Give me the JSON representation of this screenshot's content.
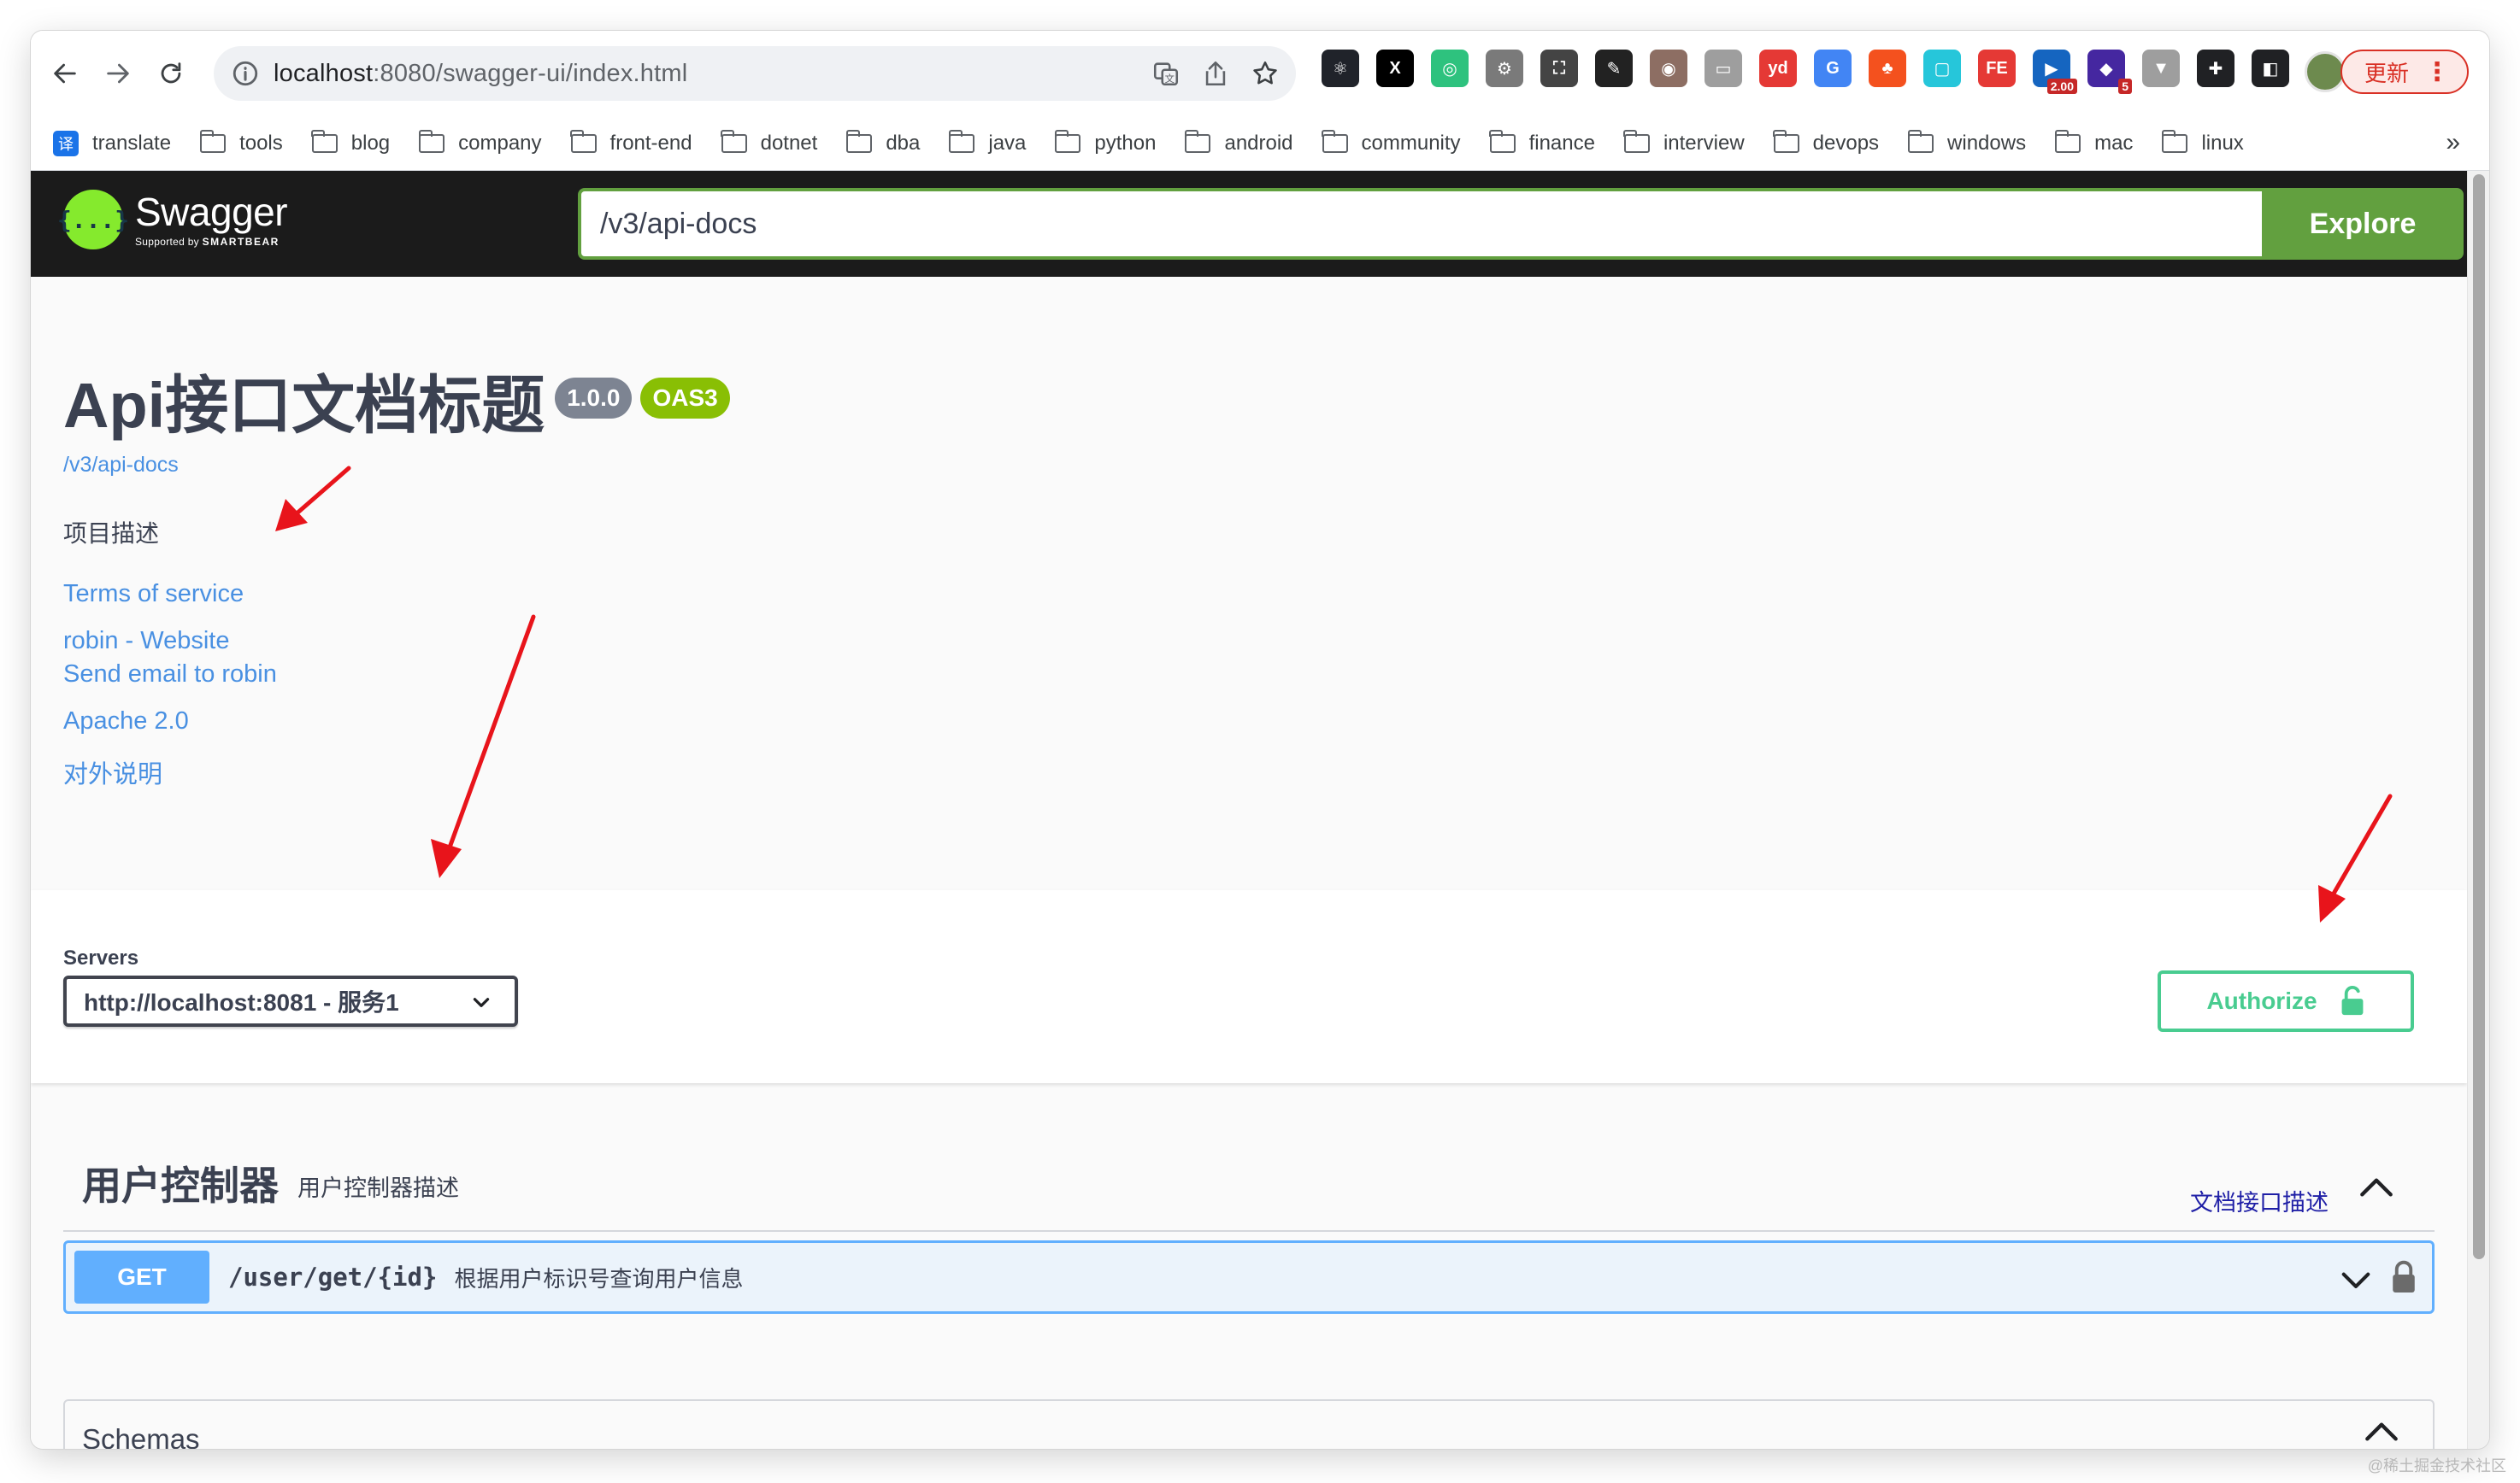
{
  "browser": {
    "url_host": "localhost",
    "url_path": ":8080/swagger-ui/index.html",
    "update_label": "更新",
    "bookmarks": [
      "translate",
      "tools",
      "blog",
      "company",
      "front-end",
      "dotnet",
      "dba",
      "java",
      "python",
      "android",
      "community",
      "finance",
      "interview",
      "devops",
      "windows",
      "mac",
      "linux"
    ],
    "translate_glyph": "译",
    "more": "»",
    "extensions": [
      {
        "name": "react-devtools-icon",
        "label": "⚛",
        "color": "#20232a"
      },
      {
        "name": "x-icon",
        "label": "X",
        "color": "#000000"
      },
      {
        "name": "circle-icon",
        "label": "◎",
        "color": "#2ec27e"
      },
      {
        "name": "gear-ext-icon",
        "label": "⚙",
        "color": "#7a7a7a"
      },
      {
        "name": "screenshot-icon",
        "label": "⛶",
        "color": "#444444"
      },
      {
        "name": "eyedropper-icon",
        "label": "✎",
        "color": "#222222"
      },
      {
        "name": "owl-icon",
        "label": "◉",
        "color": "#8d6e63"
      },
      {
        "name": "reader-icon",
        "label": "▭",
        "color": "#9e9e9e"
      },
      {
        "name": "youdao-icon",
        "label": "yd",
        "color": "#e53935"
      },
      {
        "name": "google-translate-icon",
        "label": "G",
        "color": "#4285f4"
      },
      {
        "name": "tree-icon",
        "label": "♣",
        "color": "#f4511e"
      },
      {
        "name": "frame-icon",
        "label": "▢",
        "color": "#26c6da"
      },
      {
        "name": "fe-icon",
        "label": "FE",
        "color": "#e53935"
      },
      {
        "name": "speed-icon",
        "label": "▶",
        "color": "#1565c0",
        "badge": "2.00"
      },
      {
        "name": "cube-icon",
        "label": "◆",
        "color": "#4527a0",
        "badge": "5"
      },
      {
        "name": "vue-icon",
        "label": "▼",
        "color": "#9e9e9e"
      },
      {
        "name": "puzzle-icon",
        "label": "✚",
        "color": "#202124"
      },
      {
        "name": "sidepanel-icon",
        "label": "◧",
        "color": "#202124"
      }
    ]
  },
  "swagger": {
    "logo_glyph": "{...}",
    "logo_name": "Swagger",
    "logo_sub_prefix": "Supported by",
    "logo_sub_brand": "SMARTBEAR",
    "url_input": "/v3/api-docs",
    "explore_label": "Explore"
  },
  "info": {
    "title": "Api接口文档标题",
    "version": "1.0.0",
    "oas": "OAS3",
    "url": "/v3/api-docs",
    "description": "项目描述",
    "links": {
      "terms": "Terms of service",
      "website": "robin - Website",
      "email": "Send email to robin",
      "license": "Apache 2.0",
      "external": "对外说明"
    }
  },
  "servers": {
    "label": "Servers",
    "selected": "http://localhost:8081 - 服务1",
    "authorize_label": "Authorize"
  },
  "tag": {
    "name": "用户控制器",
    "description": "用户控制器描述",
    "external_docs": "文档接口描述",
    "operations": [
      {
        "method": "GET",
        "path": "/user/get/{id}",
        "summary": "根据用户标识号查询用户信息"
      }
    ]
  },
  "schemas": {
    "title": "Schemas"
  },
  "colors": {
    "swagger_green": "#62a03f",
    "get_blue": "#61affe",
    "authorize_green": "#49cc90",
    "link_blue": "#4990e2",
    "annotation_red": "#e8141b"
  },
  "watermark": "@稀土掘金技术社区"
}
